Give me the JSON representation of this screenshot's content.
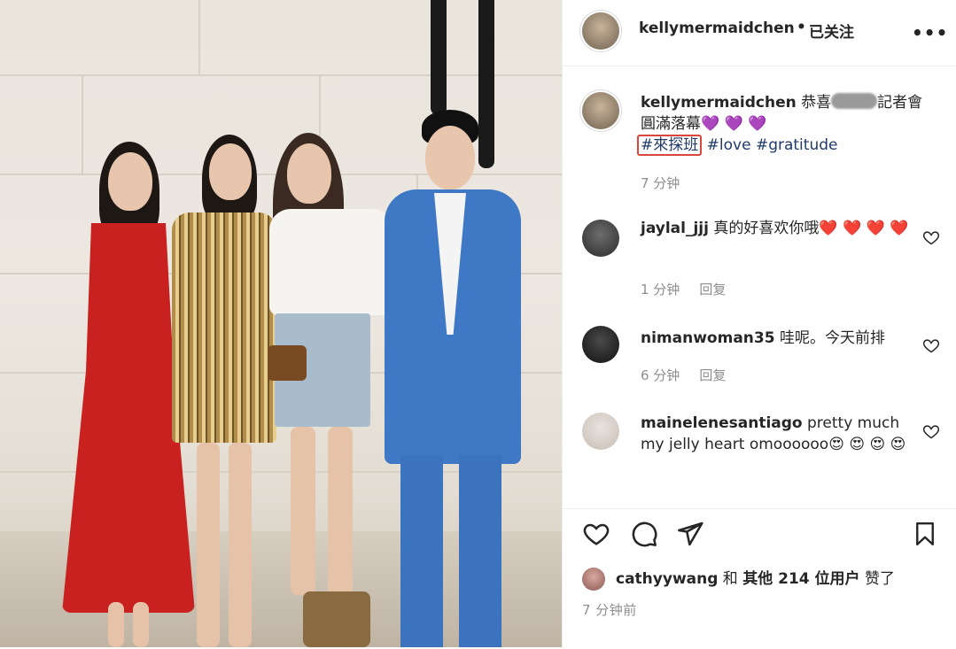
{
  "post": {
    "author": "kellymermaidchen",
    "follow_status": "已关注",
    "separator": "•",
    "more_label": "•••"
  },
  "caption": {
    "username": "kellymermaidchen",
    "text_before": "恭喜",
    "text_after": "記者會圓滿落幕",
    "emojis": "💜 💜 💜",
    "hashtag_1": "#來探班",
    "hashtag_2": "#love",
    "hashtag_3": "#gratitude",
    "time": "7 分钟"
  },
  "comments": [
    {
      "username": "jaylal_jjj",
      "text": "真的好喜欢你哦❤️ ❤️ ❤️ ❤️",
      "time": "1 分钟",
      "reply": "回复"
    },
    {
      "username": "nimanwoman35",
      "text": "哇呢。今天前排",
      "time": "6 分钟",
      "reply": "回复"
    },
    {
      "username": "mainelenesantiago",
      "text": "pretty much my jelly heart omoooooo😍 😍 😍 😍",
      "time": "",
      "reply": ""
    }
  ],
  "likes": {
    "liker": "cathyywang",
    "text_mid": "和",
    "others": "其他 214 位用户",
    "text_end": "赞了"
  },
  "timestamp": "7 分钟前",
  "colors": {
    "text": "#262626",
    "muted": "#8e8e8e",
    "hashtag": "#1f3a6b",
    "highlight_box": "#d9463b",
    "purple_heart": "#8e44d6"
  }
}
